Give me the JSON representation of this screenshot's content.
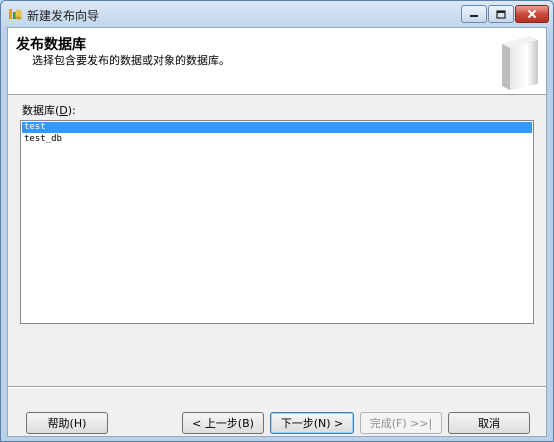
{
  "window": {
    "title": "新建发布向导",
    "minimize_icon": "minimize-icon",
    "maximize_icon": "maximize-icon",
    "close_icon": "close-icon"
  },
  "header": {
    "title": "发布数据库",
    "subtitle": "选择包含要发布的数据或对象的数据库。",
    "graphic_icon": "database-graphic"
  },
  "databases": {
    "label": "数据库",
    "label_mnemonic": "D",
    "label_suffix": "):",
    "items": [
      {
        "name": "test",
        "selected": true
      },
      {
        "name": "test_db",
        "selected": false
      }
    ]
  },
  "buttons": {
    "help": "帮助(H)",
    "back": "< 上一步(B)",
    "next": "下一步(N) >",
    "finish": "完成(F) >>|",
    "cancel": "取消"
  },
  "colors": {
    "selection": "#3399ff",
    "close_button": "#c8493b"
  }
}
